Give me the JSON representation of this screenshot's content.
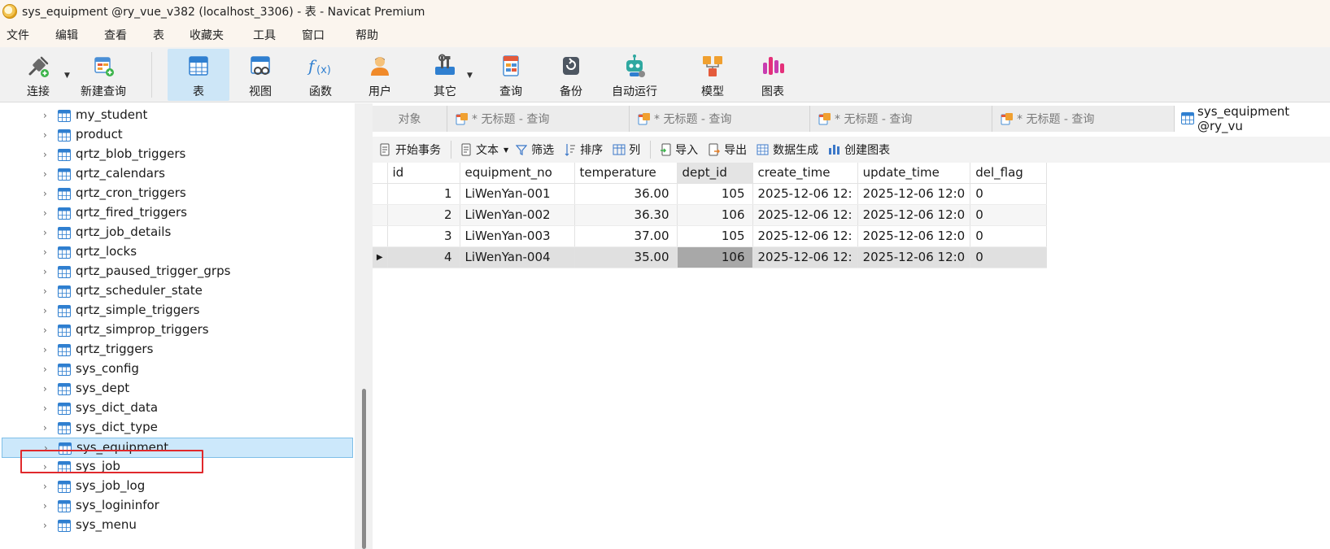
{
  "window": {
    "title": "sys_equipment @ry_vue_v382 (localhost_3306) - 表 - Navicat Premium"
  },
  "menu": [
    "文件",
    "编辑",
    "查看",
    "表",
    "收藏夹",
    "工具",
    "窗口",
    "帮助"
  ],
  "toolbar": {
    "connect": "连接",
    "new_query": "新建查询",
    "table": "表",
    "view": "视图",
    "function": "函数",
    "user": "用户",
    "other": "其它",
    "query": "查询",
    "backup": "备份",
    "automation": "自动运行",
    "model": "模型",
    "chart": "图表"
  },
  "sidebar": {
    "tables": [
      "my_student",
      "product",
      "qrtz_blob_triggers",
      "qrtz_calendars",
      "qrtz_cron_triggers",
      "qrtz_fired_triggers",
      "qrtz_job_details",
      "qrtz_locks",
      "qrtz_paused_trigger_grps",
      "qrtz_scheduler_state",
      "qrtz_simple_triggers",
      "qrtz_simprop_triggers",
      "qrtz_triggers",
      "sys_config",
      "sys_dept",
      "sys_dict_data",
      "sys_dict_type",
      "sys_equipment",
      "sys_job",
      "sys_job_log",
      "sys_logininfor",
      "sys_menu"
    ],
    "selected": "sys_equipment"
  },
  "tabs": {
    "objects": "对象",
    "query_tabs": [
      "* 无标题 - 查询",
      "* 无标题 - 查询",
      "* 无标题 - 查询",
      "* 无标题 - 查询"
    ],
    "active": "sys_equipment @ry_vu"
  },
  "subtoolbar": {
    "begin_transaction": "开始事务",
    "text": "文本",
    "filter": "筛选",
    "sort": "排序",
    "columns": "列",
    "import": "导入",
    "export": "导出",
    "data_generation": "数据生成",
    "create_chart": "创建图表"
  },
  "grid": {
    "columns": [
      "id",
      "equipment_no",
      "temperature",
      "dept_id",
      "create_time",
      "update_time",
      "del_flag"
    ],
    "rows": [
      [
        "1",
        "LiWenYan-001",
        "36.00",
        "105",
        "2025-12-06 12:",
        "2025-12-06 12:0",
        "0"
      ],
      [
        "2",
        "LiWenYan-002",
        "36.30",
        "106",
        "2025-12-06 12:",
        "2025-12-06 12:0",
        "0"
      ],
      [
        "3",
        "LiWenYan-003",
        "37.00",
        "105",
        "2025-12-06 12:",
        "2025-12-06 12:0",
        "0"
      ],
      [
        "4",
        "LiWenYan-004",
        "35.00",
        "106",
        "2025-12-06 12:",
        "2025-12-06 12:0",
        "0"
      ]
    ],
    "current_row_marker": "▶"
  }
}
